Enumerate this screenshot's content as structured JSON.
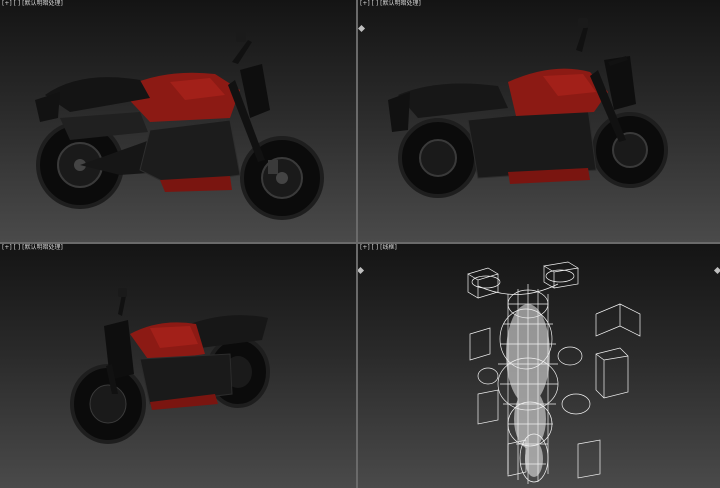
{
  "viewports": [
    {
      "id": "top-left",
      "label": "[+] [ ] [默认明暗处理]"
    },
    {
      "id": "top-right",
      "label": "[+] [ ] [默认明暗处理]"
    },
    {
      "id": "bottom-left",
      "label": "[+] [ ] [默认明暗处理]"
    },
    {
      "id": "bottom-right",
      "label": "[+] [ ] [线框]"
    }
  ],
  "colors": {
    "accent_border": "#e0b030",
    "bike_body": "#8c1a14",
    "bike_dark": "#0e0e0e",
    "wireframe": "#f2f2f2"
  },
  "icons": {
    "viewcube": "viewcube-icon"
  }
}
